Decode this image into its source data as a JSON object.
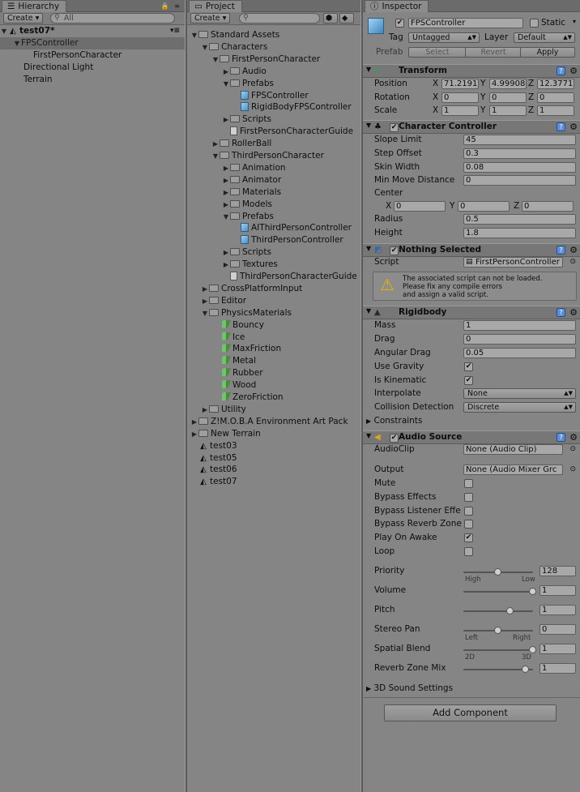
{
  "hierarchy": {
    "tab": "Hierarchy",
    "create": "Create",
    "search": "All",
    "scene": "test07*",
    "items": [
      "FPSController",
      "FirstPersonCharacter",
      "Directional Light",
      "Terrain"
    ]
  },
  "project": {
    "tab": "Project",
    "create": "Create",
    "tree": [
      {
        "label": "Standard Assets",
        "depth": 0,
        "icon": "folder",
        "expanded": true
      },
      {
        "label": "Characters",
        "depth": 1,
        "icon": "folder",
        "expanded": true
      },
      {
        "label": "FirstPersonCharacter",
        "depth": 2,
        "icon": "folder",
        "expanded": true
      },
      {
        "label": "Audio",
        "depth": 3,
        "icon": "folder",
        "expanded": false
      },
      {
        "label": "Prefabs",
        "depth": 3,
        "icon": "folder",
        "expanded": true
      },
      {
        "label": "FPSController",
        "depth": 4,
        "icon": "prefab",
        "expanded": null
      },
      {
        "label": "RigidBodyFPSController",
        "depth": 4,
        "icon": "prefab",
        "expanded": null
      },
      {
        "label": "Scripts",
        "depth": 3,
        "icon": "folder",
        "expanded": false
      },
      {
        "label": "FirstPersonCharacterGuide",
        "depth": 3,
        "icon": "doc",
        "expanded": null
      },
      {
        "label": "RollerBall",
        "depth": 2,
        "icon": "folder",
        "expanded": false
      },
      {
        "label": "ThirdPersonCharacter",
        "depth": 2,
        "icon": "folder",
        "expanded": true
      },
      {
        "label": "Animation",
        "depth": 3,
        "icon": "folder",
        "expanded": false
      },
      {
        "label": "Animator",
        "depth": 3,
        "icon": "folder",
        "expanded": false
      },
      {
        "label": "Materials",
        "depth": 3,
        "icon": "folder",
        "expanded": false
      },
      {
        "label": "Models",
        "depth": 3,
        "icon": "folder",
        "expanded": false
      },
      {
        "label": "Prefabs",
        "depth": 3,
        "icon": "folder",
        "expanded": true
      },
      {
        "label": "AIThirdPersonController",
        "depth": 4,
        "icon": "prefab",
        "expanded": null
      },
      {
        "label": "ThirdPersonController",
        "depth": 4,
        "icon": "prefab",
        "expanded": null
      },
      {
        "label": "Scripts",
        "depth": 3,
        "icon": "folder",
        "expanded": false
      },
      {
        "label": "Textures",
        "depth": 3,
        "icon": "folder",
        "expanded": false
      },
      {
        "label": "ThirdPersonCharacterGuide",
        "depth": 3,
        "icon": "doc",
        "expanded": null
      },
      {
        "label": "CrossPlatformInput",
        "depth": 1,
        "icon": "folder",
        "expanded": false
      },
      {
        "label": "Editor",
        "depth": 1,
        "icon": "folder",
        "expanded": false
      },
      {
        "label": "PhysicsMaterials",
        "depth": 1,
        "icon": "folder",
        "expanded": true
      },
      {
        "label": "Bouncy",
        "depth": 2,
        "icon": "mat",
        "expanded": null
      },
      {
        "label": "Ice",
        "depth": 2,
        "icon": "mat",
        "expanded": null
      },
      {
        "label": "MaxFriction",
        "depth": 2,
        "icon": "mat",
        "expanded": null
      },
      {
        "label": "Metal",
        "depth": 2,
        "icon": "mat",
        "expanded": null
      },
      {
        "label": "Rubber",
        "depth": 2,
        "icon": "mat",
        "expanded": null
      },
      {
        "label": "Wood",
        "depth": 2,
        "icon": "mat",
        "expanded": null
      },
      {
        "label": "ZeroFriction",
        "depth": 2,
        "icon": "mat",
        "expanded": null
      },
      {
        "label": "Utility",
        "depth": 1,
        "icon": "folder",
        "expanded": false
      },
      {
        "label": "Z!M.O.B.A Environment Art Pack",
        "depth": 0,
        "icon": "folder",
        "expanded": false
      },
      {
        "label": "New Terrain",
        "depth": 0,
        "icon": "folder",
        "expanded": false
      },
      {
        "label": "test03",
        "depth": 0,
        "icon": "unity",
        "expanded": null
      },
      {
        "label": "test05",
        "depth": 0,
        "icon": "unity",
        "expanded": null
      },
      {
        "label": "test06",
        "depth": 0,
        "icon": "unity",
        "expanded": null
      },
      {
        "label": "test07",
        "depth": 0,
        "icon": "unity",
        "expanded": null
      }
    ]
  },
  "inspector": {
    "tab": "Inspector",
    "name": "FPSController",
    "static": "Static",
    "tag_label": "Tag",
    "tag": "Untagged",
    "layer_label": "Layer",
    "layer": "Default",
    "prefab": "Prefab",
    "select": "Select",
    "revert": "Revert",
    "apply": "Apply",
    "transform": {
      "title": "Transform",
      "position": [
        "71.2191",
        "4.99908",
        "12.3771"
      ],
      "rotation": [
        "0",
        "0",
        "0"
      ],
      "scale": [
        "1",
        "1",
        "1"
      ],
      "labels": [
        "Position",
        "Rotation",
        "Scale"
      ]
    },
    "cc": {
      "title": "Character Controller",
      "rows": [
        [
          "Slope Limit",
          "45"
        ],
        [
          "Step Offset",
          "0.3"
        ],
        [
          "Skin Width",
          "0.08"
        ],
        [
          "Min Move Distance",
          "0"
        ]
      ],
      "center": "Center",
      "center_vals": [
        "0",
        "0",
        "0"
      ],
      "radius_label": "Radius",
      "radius": "0.5",
      "height_label": "Height",
      "height": "1.8"
    },
    "script": {
      "title": "Nothing Selected",
      "label": "Script",
      "value": "FirstPersonController",
      "warning": "The associated script can not be loaded.\nPlease fix any compile errors\nand assign a valid script."
    },
    "rb": {
      "title": "Rigidbody",
      "mass_label": "Mass",
      "mass": "1",
      "drag_label": "Drag",
      "drag": "0",
      "adrag_label": "Angular Drag",
      "adrag": "0.05",
      "grav_label": "Use Gravity",
      "kin_label": "Is Kinematic",
      "interp_label": "Interpolate",
      "interp": "None",
      "coll_label": "Collision Detection",
      "coll": "Discrete",
      "constraints": "Constraints"
    },
    "audio": {
      "title": "Audio Source",
      "clip_label": "AudioClip",
      "clip": "None (Audio Clip)",
      "out_label": "Output",
      "out": "None (Audio Mixer Grc",
      "toggles": [
        [
          "Mute",
          false
        ],
        [
          "Bypass Effects",
          false
        ],
        [
          "Bypass Listener Effe",
          false
        ],
        [
          "Bypass Reverb Zone",
          false
        ],
        [
          "Play On Awake",
          true
        ],
        [
          "Loop",
          false
        ]
      ],
      "sliders": [
        {
          "label": "Priority",
          "value": "128",
          "level": 0.5,
          "left": "High",
          "right": "Low"
        },
        {
          "label": "Volume",
          "value": "1",
          "level": 1.0,
          "left": "",
          "right": ""
        },
        {
          "label": "Pitch",
          "value": "1",
          "level": 0.67,
          "left": "",
          "right": ""
        },
        {
          "label": "Stereo Pan",
          "value": "0",
          "level": 0.5,
          "left": "Left",
          "right": "Right"
        },
        {
          "label": "Spatial Blend",
          "value": "1",
          "level": 1.0,
          "left": "2D",
          "right": "3D"
        },
        {
          "label": "Reverb Zone Mix",
          "value": "1",
          "level": 0.9,
          "left": "",
          "right": ""
        }
      ],
      "settings3d": "3D Sound Settings"
    },
    "add": "Add Component"
  }
}
